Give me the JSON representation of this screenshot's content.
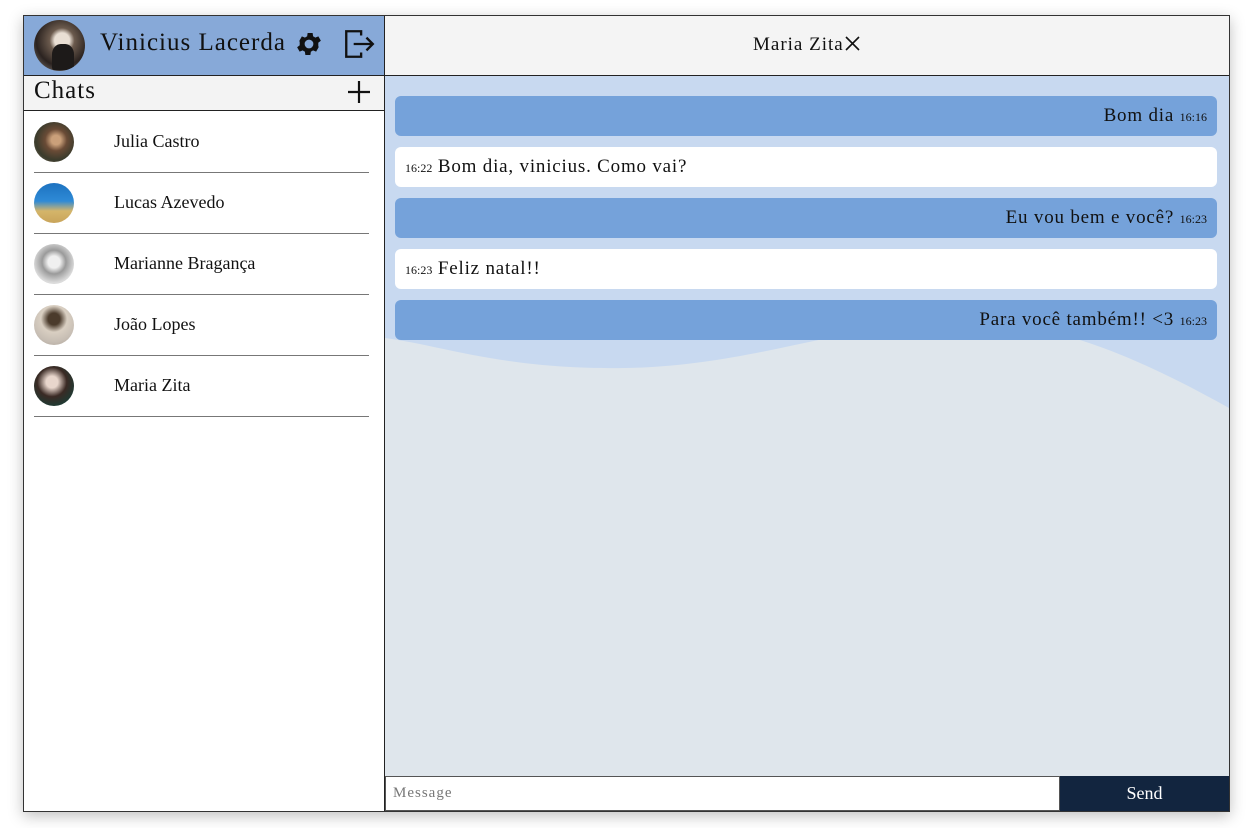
{
  "user": {
    "name": "Vinicius Lacerda"
  },
  "icons": {
    "settings": "gear-icon",
    "logout": "logout-icon",
    "add_chat": "plus-icon",
    "close": "close-icon"
  },
  "colors": {
    "profile_bar": "#87a9d8",
    "sent_bubble": "#75a2da",
    "received_bubble": "#ffffff",
    "chat_background": "#dfe6ec",
    "send_button": "#12253f"
  },
  "sidebar": {
    "title": "Chats",
    "chats": [
      {
        "name": "Julia Castro"
      },
      {
        "name": "Lucas Azevedo"
      },
      {
        "name": "Marianne Bragança"
      },
      {
        "name": "João Lopes"
      },
      {
        "name": "Maria Zita"
      }
    ]
  },
  "conversation": {
    "title": "Maria Zita",
    "messages": [
      {
        "direction": "sent",
        "text": "Bom dia",
        "time": "16:16"
      },
      {
        "direction": "received",
        "text": "Bom dia, vinicius. Como vai?",
        "time": "16:22"
      },
      {
        "direction": "sent",
        "text": "Eu vou bem e você?",
        "time": "16:23"
      },
      {
        "direction": "received",
        "text": "Feliz natal!!",
        "time": "16:23"
      },
      {
        "direction": "sent",
        "text": "Para você também!! <3",
        "time": "16:23"
      }
    ]
  },
  "composer": {
    "placeholder": "Message",
    "value": "",
    "send_label": "Send"
  }
}
